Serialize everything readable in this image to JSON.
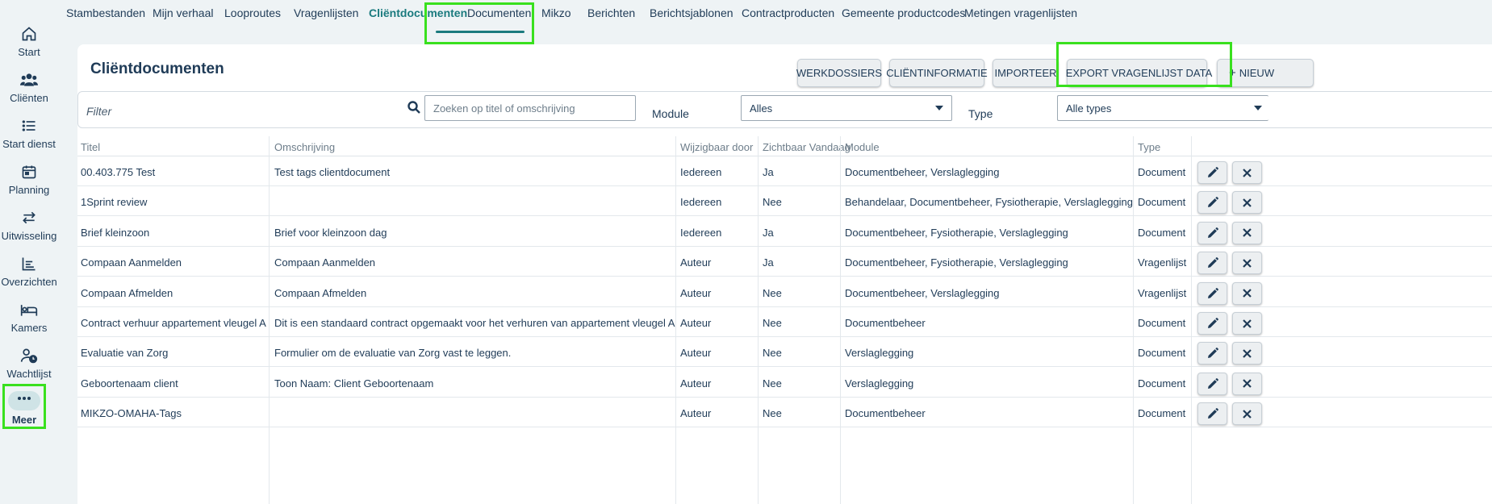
{
  "sidebar": {
    "items": [
      {
        "label": "Start",
        "icon": "home-icon"
      },
      {
        "label": "Cliënten",
        "icon": "people-icon"
      },
      {
        "label": "Start dienst",
        "icon": "list-icon"
      },
      {
        "label": "Planning",
        "icon": "calendar-icon"
      },
      {
        "label": "Uitwisseling",
        "icon": "swap-icon"
      },
      {
        "label": "Overzichten",
        "icon": "chart-icon"
      },
      {
        "label": "Kamers",
        "icon": "bed-icon"
      },
      {
        "label": "Wachtlijst",
        "icon": "person-clock-icon"
      },
      {
        "label": "Meer",
        "icon": "more-icon"
      }
    ]
  },
  "tabs": [
    "Stambestanden",
    "Mijn verhaal",
    "Looproutes",
    "Vragenlijsten",
    "Cliëntdocumenten",
    "Documenten",
    "Mikzo",
    "Berichten",
    "Berichtsjablonen",
    "Contractproducten",
    "Gemeente productcodes",
    "Metingen vragenlijsten"
  ],
  "page": {
    "title": "Cliëntdocumenten",
    "buttons": {
      "werkdossiers": "WERKDOSSIERS",
      "clientinformatie": "CLIËNTINFORMATIE",
      "importeer": "IMPORTEER",
      "export": "EXPORT VRAGENLIJST DATA",
      "nieuw": "NIEUW"
    }
  },
  "filter": {
    "label": "Filter",
    "search_placeholder": "Zoeken op titel of omschrijving",
    "module_label": "Module",
    "module_value": "Alles",
    "type_label": "Type",
    "type_value": "Alle types"
  },
  "table": {
    "headers": [
      "Titel",
      "Omschrijving",
      "Wijzigbaar door",
      "Zichtbaar Vandaag",
      "Module",
      "Type"
    ],
    "rows": [
      [
        "00.403.775 Test",
        "Test tags clientdocument",
        "Iedereen",
        "Ja",
        "Documentbeheer, Verslaglegging",
        "Document"
      ],
      [
        "1Sprint review",
        "",
        "Iedereen",
        "Nee",
        "Behandelaar, Documentbeheer, Fysiotherapie, Verslaglegging",
        "Document"
      ],
      [
        "Brief kleinzoon",
        "Brief voor kleinzoon dag",
        "Iedereen",
        "Ja",
        "Documentbeheer, Fysiotherapie, Verslaglegging",
        "Document"
      ],
      [
        "Compaan Aanmelden",
        "Compaan Aanmelden",
        "Auteur",
        "Ja",
        "Documentbeheer, Fysiotherapie, Verslaglegging",
        "Vragenlijst"
      ],
      [
        "Compaan Afmelden",
        "Compaan Afmelden",
        "Auteur",
        "Nee",
        "Documentbeheer, Verslaglegging",
        "Vragenlijst"
      ],
      [
        "Contract verhuur appartement vleugel A",
        "Dit is een standaard contract opgemaakt voor het verhuren van appartement vleugel A",
        "Auteur",
        "Nee",
        "Documentbeheer",
        "Document"
      ],
      [
        "Evaluatie van Zorg",
        "Formulier om de evaluatie van Zorg vast te leggen.",
        "Auteur",
        "Nee",
        "Verslaglegging",
        "Document"
      ],
      [
        "Geboortenaam client",
        "Toon Naam: Client Geboortenaam",
        "Auteur",
        "Nee",
        "Verslaglegging",
        "Document"
      ],
      [
        "MIKZO-OMAHA-Tags",
        "",
        "Auteur",
        "Nee",
        "Documentbeheer",
        "Document"
      ]
    ]
  },
  "colors": {
    "accent": "#1a7a7e",
    "highlight": "#39e01e",
    "text": "#1f3b57"
  }
}
